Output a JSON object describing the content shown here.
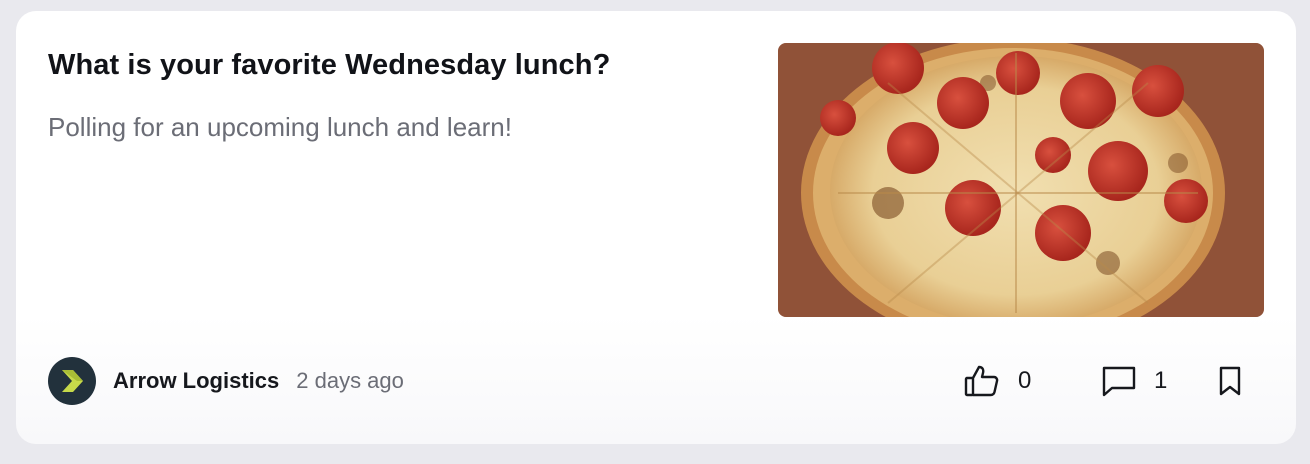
{
  "post": {
    "title": "What is your favorite Wednesday lunch?",
    "description": "Polling for an upcoming lunch and learn!",
    "image_alt": "pepperoni pizza"
  },
  "author": {
    "name": "Arrow Logistics",
    "time_ago": "2 days ago",
    "avatar_bg": "#22313c",
    "avatar_accent": "#c6d94a"
  },
  "actions": {
    "likes": "0",
    "comments": "1",
    "icons": [
      "thumbs-up-icon",
      "comment-icon",
      "bookmark-icon"
    ]
  }
}
